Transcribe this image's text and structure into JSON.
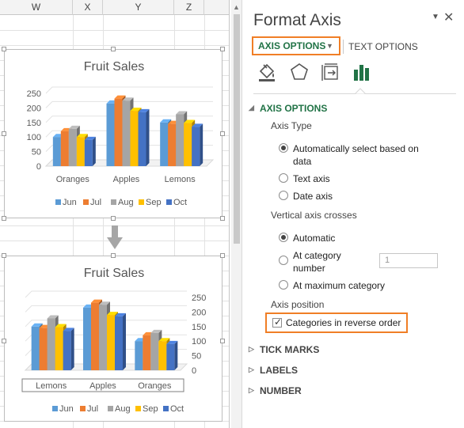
{
  "sheet": {
    "columns": [
      "W",
      "X",
      "Y",
      "Z"
    ]
  },
  "charts": [
    {
      "title": "Fruit Sales",
      "axis_side": "left",
      "categories": [
        "Oranges",
        "Apples",
        "Lemons"
      ]
    },
    {
      "title": "Fruit Sales",
      "axis_side": "right",
      "categories": [
        "Lemons",
        "Apples",
        "Oranges"
      ]
    }
  ],
  "chart_data": [
    {
      "type": "bar",
      "title": "Fruit Sales",
      "categories": [
        "Oranges",
        "Apples",
        "Lemons"
      ],
      "series": [
        {
          "name": "Jun",
          "values": [
            100,
            215,
            150
          ],
          "color": "#5b9bd5"
        },
        {
          "name": "Jul",
          "values": [
            120,
            232,
            145
          ],
          "color": "#ed7d31"
        },
        {
          "name": "Aug",
          "values": [
            128,
            225,
            178
          ],
          "color": "#a5a5a5"
        },
        {
          "name": "Sep",
          "values": [
            100,
            190,
            148
          ],
          "color": "#ffc000"
        },
        {
          "name": "Oct",
          "values": [
            90,
            185,
            135
          ],
          "color": "#4472c4"
        }
      ],
      "yticks": [
        "0",
        "50",
        "100",
        "150",
        "200",
        "250"
      ],
      "ylim": [
        0,
        250
      ],
      "legend_position": "bottom",
      "category_order": "normal"
    },
    {
      "type": "bar",
      "title": "Fruit Sales",
      "categories": [
        "Lemons",
        "Apples",
        "Oranges"
      ],
      "series": [
        {
          "name": "Jun",
          "values": [
            150,
            215,
            100
          ],
          "color": "#5b9bd5"
        },
        {
          "name": "Jul",
          "values": [
            145,
            232,
            120
          ],
          "color": "#ed7d31"
        },
        {
          "name": "Aug",
          "values": [
            178,
            225,
            128
          ],
          "color": "#a5a5a5"
        },
        {
          "name": "Sep",
          "values": [
            148,
            190,
            100
          ],
          "color": "#ffc000"
        },
        {
          "name": "Oct",
          "values": [
            135,
            185,
            90
          ],
          "color": "#4472c4"
        }
      ],
      "yticks": [
        "0",
        "50",
        "100",
        "150",
        "200",
        "250"
      ],
      "ylim": [
        0,
        250
      ],
      "legend_position": "bottom",
      "category_order": "reverse"
    }
  ],
  "pane": {
    "title": "Format Axis",
    "menu_icon": "dropdown-triangle",
    "close_icon": "close-x",
    "tabs": {
      "axis_options": "AXIS OPTIONS",
      "text_options": "TEXT OPTIONS"
    },
    "icons": [
      "fill-line-icon",
      "effects-pentagon-icon",
      "size-properties-icon",
      "axis-options-bar-chart-icon"
    ],
    "sections": {
      "axis_options": "AXIS OPTIONS",
      "tick_marks": "TICK MARKS",
      "labels": "LABELS",
      "number": "NUMBER"
    },
    "axis_type": {
      "label": "Axis Type",
      "options": [
        "Automatically select based on",
        "data",
        "Text axis",
        "Date axis"
      ],
      "selected": "Automatically select based on data"
    },
    "vertical_crosses": {
      "label": "Vertical axis crosses",
      "automatic": "Automatic",
      "at_category_line1": "At category",
      "at_category_line2": "number",
      "at_category_value": "1",
      "at_max": "At maximum category",
      "selected": "Automatic"
    },
    "axis_position": {
      "label": "Axis position",
      "reverse_label": "Categories in reverse order",
      "reverse_checked": true,
      "check_glyph": "✓"
    },
    "colors": {
      "accent_green": "#217346",
      "highlight_orange": "#f07e26"
    }
  }
}
